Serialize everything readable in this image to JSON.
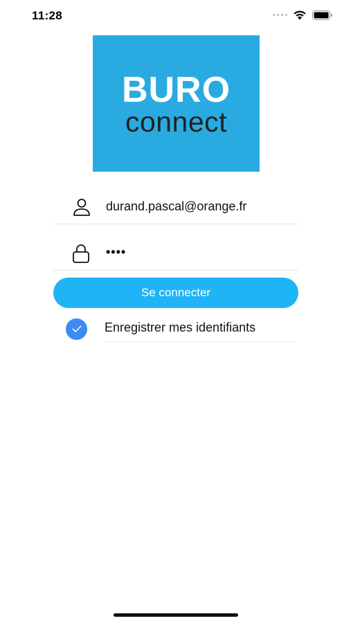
{
  "status_bar": {
    "time": "11:28",
    "icons": [
      "cellular-signal-icon",
      "wifi-icon",
      "battery-icon"
    ]
  },
  "logo": {
    "line1": "BURO",
    "line2": "connect",
    "background_color": "#29abe2"
  },
  "login_form": {
    "username": {
      "value": "durand.pascal@orange.fr",
      "icon": "user-icon"
    },
    "password": {
      "masked_value": "••••",
      "icon": "lock-icon"
    },
    "submit_label": "Se connecter",
    "remember": {
      "label": "Enregistrer mes identifiants",
      "checked": true
    }
  },
  "colors": {
    "accent": "#1fb4f5",
    "checkbox": "#3b8cf0"
  }
}
